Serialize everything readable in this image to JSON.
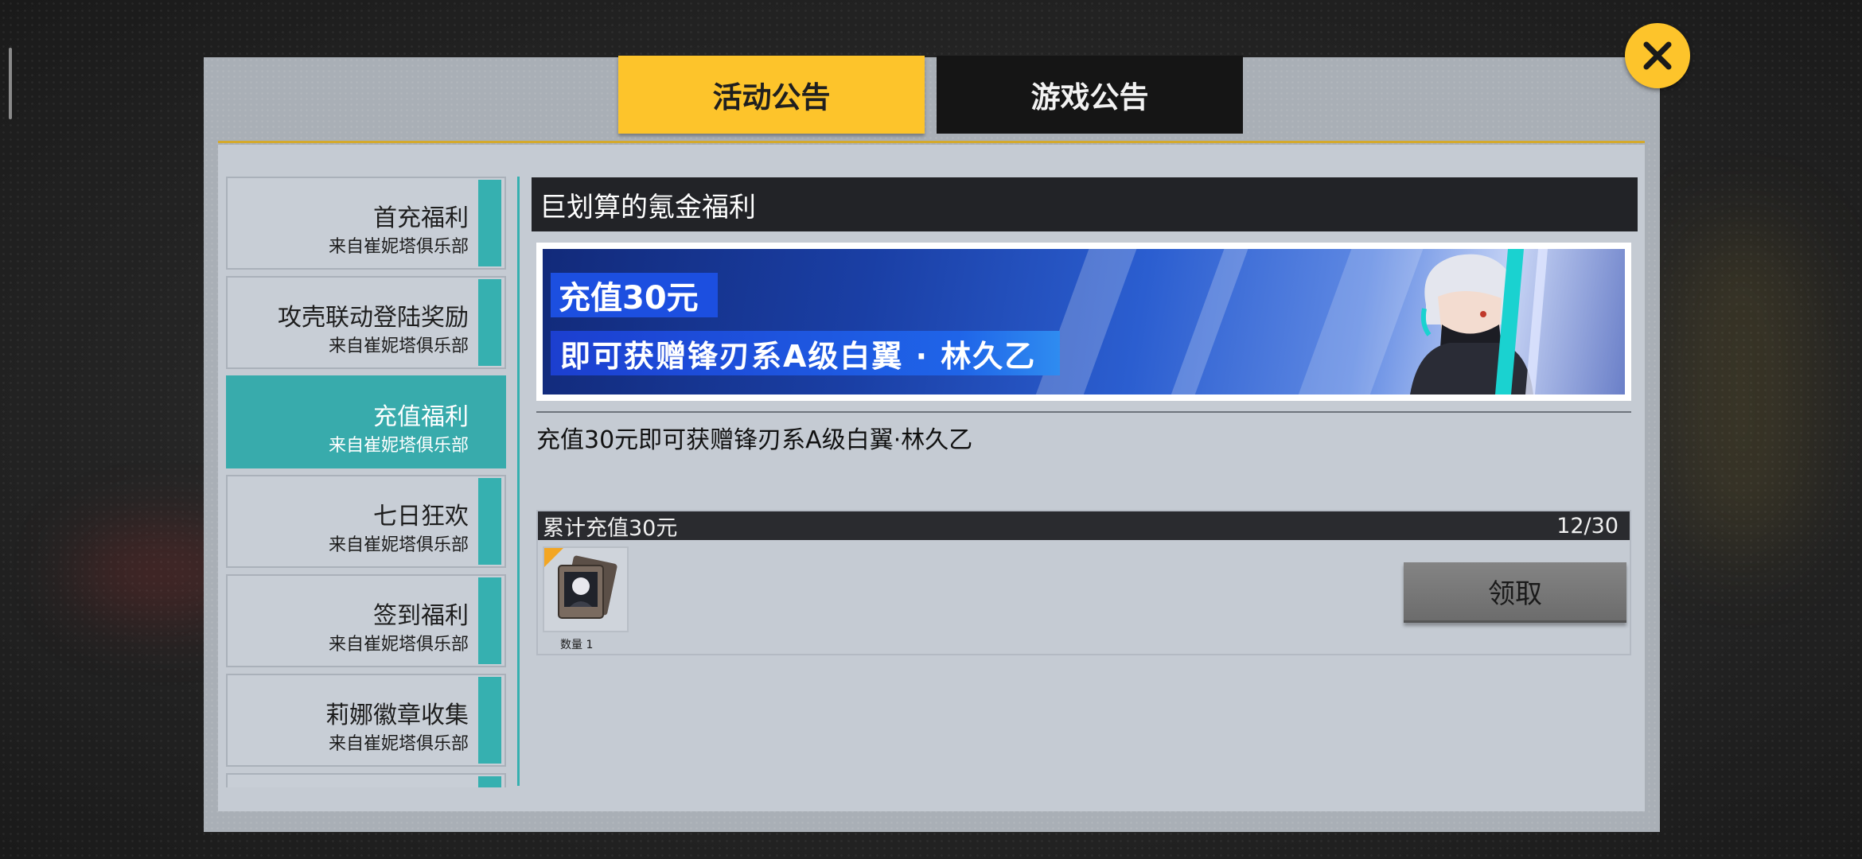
{
  "tabs": {
    "activity": "活动公告",
    "game": "游戏公告"
  },
  "close_icon": "close-icon",
  "sidebar": {
    "items": [
      {
        "label": "首充福利",
        "sub": "来自崔妮塔俱乐部"
      },
      {
        "label": "攻壳联动登陆奖励",
        "sub": "来自崔妮塔俱乐部"
      },
      {
        "label": "充值福利",
        "sub": "来自崔妮塔俱乐部",
        "active": true
      },
      {
        "label": "七日狂欢",
        "sub": "来自崔妮塔俱乐部"
      },
      {
        "label": "签到福利",
        "sub": "来自崔妮塔俱乐部"
      },
      {
        "label": "莉娜徽章收集",
        "sub": "来自崔妮塔俱乐部"
      }
    ]
  },
  "content": {
    "title": "巨划算的氪金福利",
    "banner": {
      "line1": "充值30元",
      "line2": "即可获赠锋刃系A级白翼 · 林久乙"
    },
    "description": "充值30元即可获赠锋刃系A级白翼·林久乙",
    "reward": {
      "header": "累计充值30元",
      "progress": "12/30",
      "item_qty": "数量 1",
      "claim_label": "领取"
    }
  },
  "colors": {
    "accent_yellow": "#fdc42b",
    "teal": "#36b0b0",
    "dark": "#151515"
  }
}
